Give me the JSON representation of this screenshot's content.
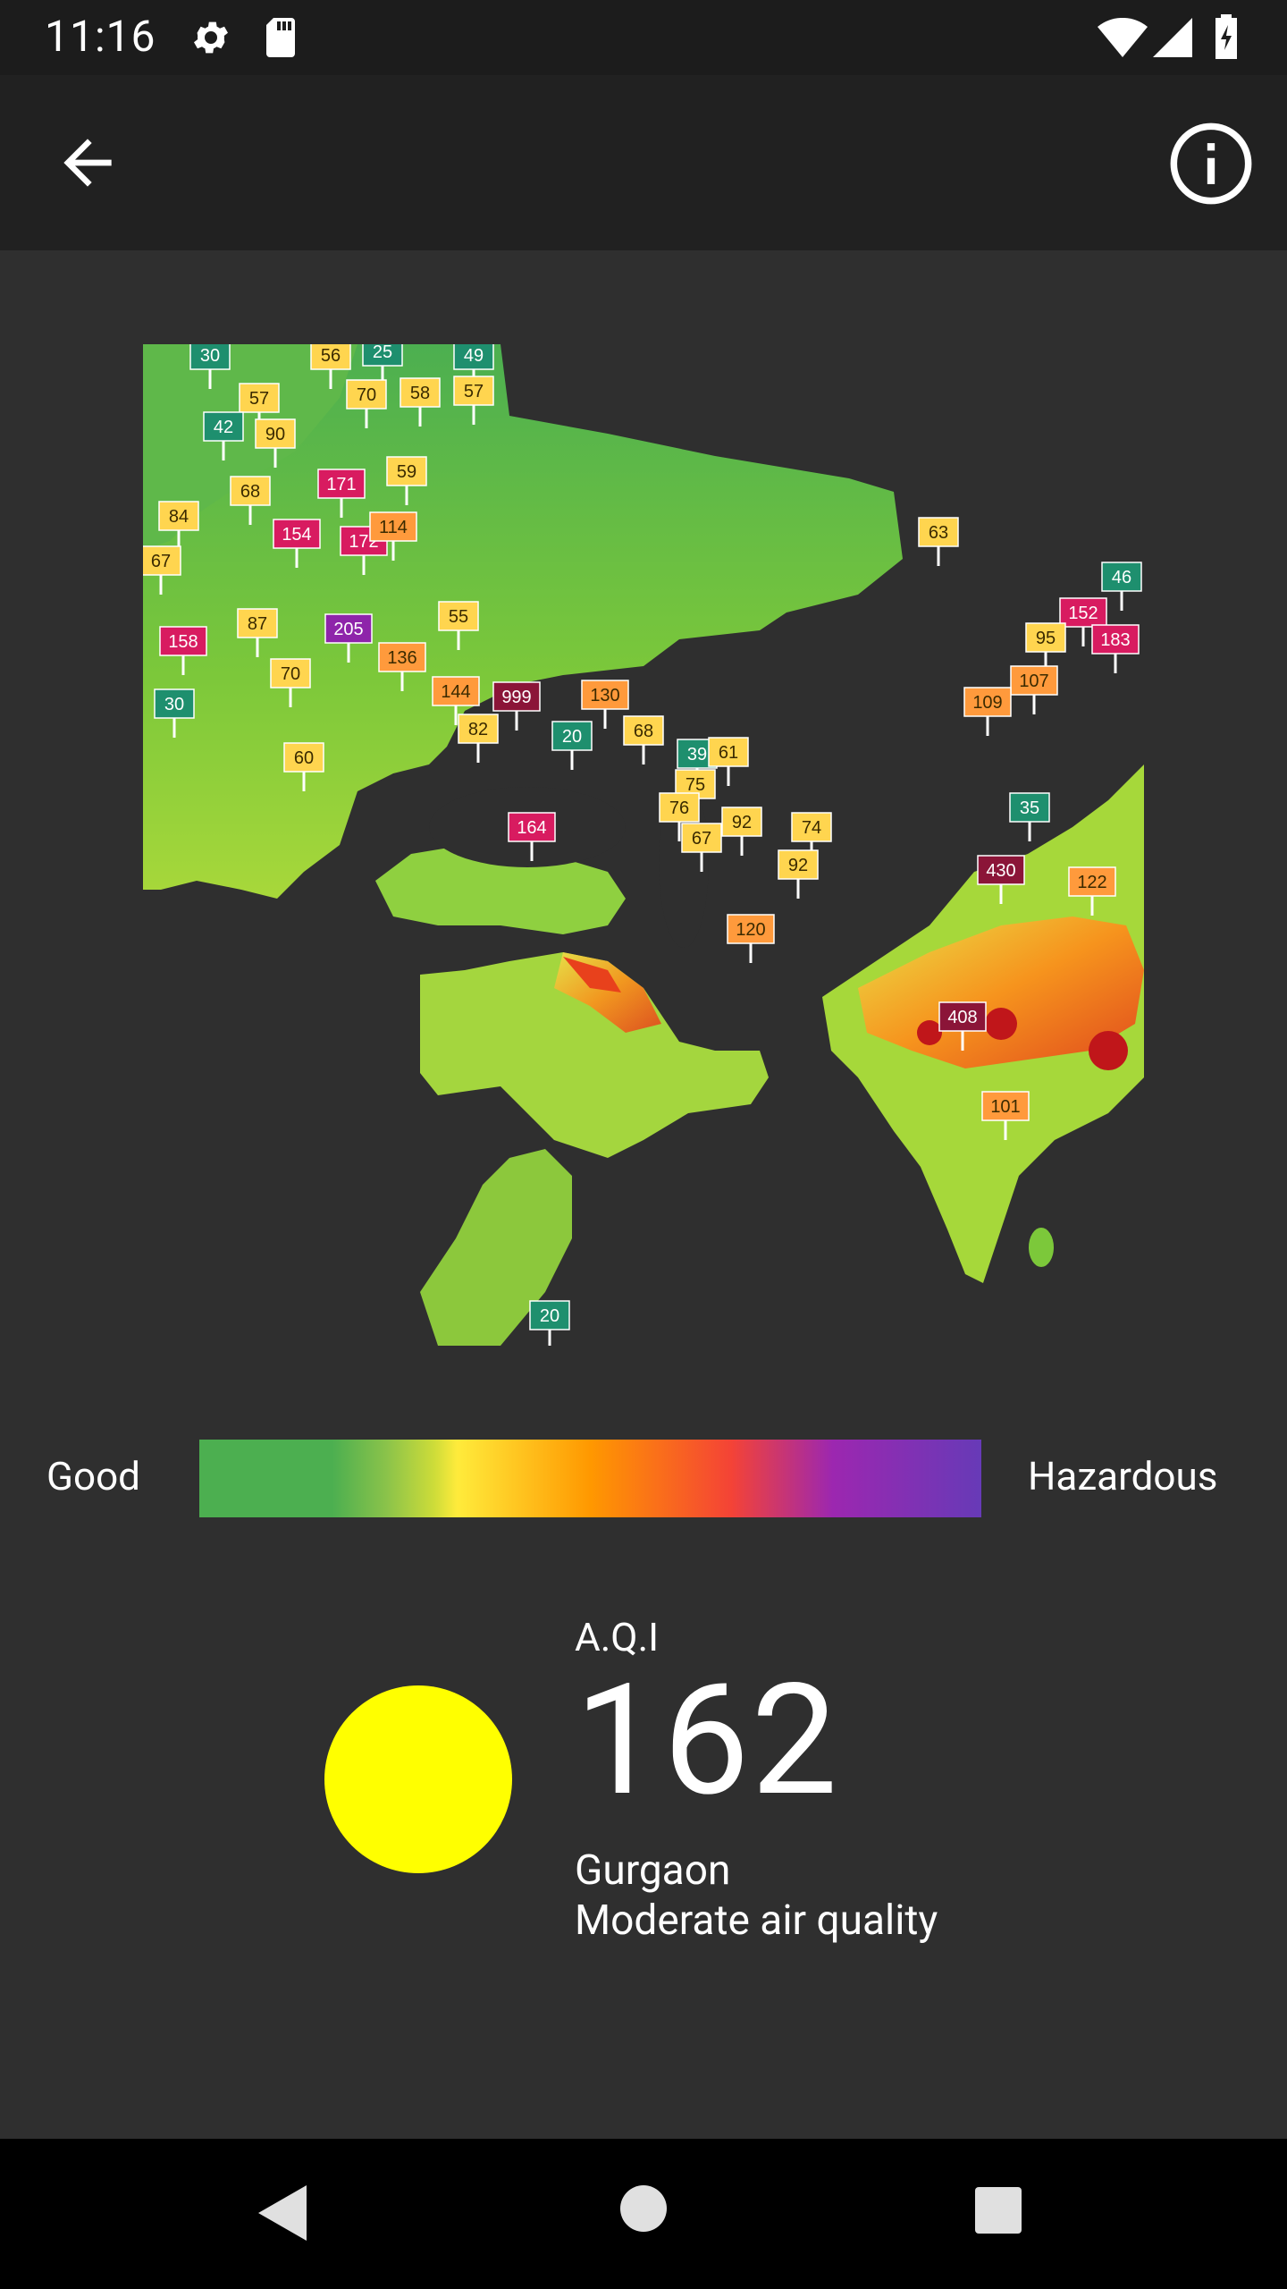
{
  "status_bar": {
    "time": "11:16",
    "icons": [
      "gear-icon",
      "sd-card-icon",
      "wifi-icon",
      "signal-icon",
      "battery-charging-icon"
    ]
  },
  "app_bar": {
    "back_icon": "arrow-back-icon",
    "info_icon": "info-icon"
  },
  "map": {
    "markers": [
      {
        "label": "30",
        "color": "#1e8f6e"
      },
      {
        "label": "56",
        "color": "#ffd54f"
      },
      {
        "label": "25",
        "color": "#1e8f6e"
      },
      {
        "label": "49",
        "color": "#1e8f6e"
      },
      {
        "label": "57",
        "color": "#ffd54f"
      },
      {
        "label": "70",
        "color": "#ffd54f"
      },
      {
        "label": "58",
        "color": "#ffd54f"
      },
      {
        "label": "57",
        "color": "#ffd54f"
      },
      {
        "label": "42",
        "color": "#1e8f6e"
      },
      {
        "label": "90",
        "color": "#ffd54f"
      },
      {
        "label": "59",
        "color": "#ffd54f"
      },
      {
        "label": "171",
        "color": "#d81b60"
      },
      {
        "label": "68",
        "color": "#ffd54f"
      },
      {
        "label": "84",
        "color": "#ffd54f"
      },
      {
        "label": "154",
        "color": "#d81b60"
      },
      {
        "label": "172",
        "color": "#d81b60"
      },
      {
        "label": "114",
        "color": "#ff9a3c"
      },
      {
        "label": "67",
        "color": "#ffd54f"
      },
      {
        "label": "63",
        "color": "#ffd54f"
      },
      {
        "label": "46",
        "color": "#1e8f6e"
      },
      {
        "label": "152",
        "color": "#d81b60"
      },
      {
        "label": "183",
        "color": "#d81b60"
      },
      {
        "label": "95",
        "color": "#ffd54f"
      },
      {
        "label": "87",
        "color": "#ffd54f"
      },
      {
        "label": "205",
        "color": "#8e24aa"
      },
      {
        "label": "55",
        "color": "#ffd54f"
      },
      {
        "label": "158",
        "color": "#d81b60"
      },
      {
        "label": "136",
        "color": "#ff9a3c"
      },
      {
        "label": "70",
        "color": "#ffd54f"
      },
      {
        "label": "30",
        "color": "#1e8f6e"
      },
      {
        "label": "144",
        "color": "#ff9a3c"
      },
      {
        "label": "999",
        "color": "#8b1538"
      },
      {
        "label": "130",
        "color": "#ff9a3c"
      },
      {
        "label": "107",
        "color": "#ff9a3c"
      },
      {
        "label": "109",
        "color": "#ff9a3c"
      },
      {
        "label": "82",
        "color": "#ffd54f"
      },
      {
        "label": "20",
        "color": "#1e8f6e"
      },
      {
        "label": "68",
        "color": "#ffd54f"
      },
      {
        "label": "39",
        "color": "#1e8f6e"
      },
      {
        "label": "61",
        "color": "#ffd54f"
      },
      {
        "label": "60",
        "color": "#ffd54f"
      },
      {
        "label": "75",
        "color": "#ffd54f"
      },
      {
        "label": "76",
        "color": "#ffd54f"
      },
      {
        "label": "92",
        "color": "#ffd54f"
      },
      {
        "label": "74",
        "color": "#ffd54f"
      },
      {
        "label": "35",
        "color": "#1e8f6e"
      },
      {
        "label": "164",
        "color": "#d81b60"
      },
      {
        "label": "67",
        "color": "#ffd54f"
      },
      {
        "label": "92",
        "color": "#ffd54f"
      },
      {
        "label": "430",
        "color": "#8b1538"
      },
      {
        "label": "122",
        "color": "#ff9a3c"
      },
      {
        "label": "120",
        "color": "#ff9a3c"
      },
      {
        "label": "408",
        "color": "#8b1538"
      },
      {
        "label": "101",
        "color": "#ff9a3c"
      },
      {
        "label": "20",
        "color": "#1e8f6e"
      }
    ]
  },
  "legend": {
    "good_label": "Good",
    "hazardous_label": "Hazardous"
  },
  "aqi": {
    "label": "A.Q.I",
    "value": "162",
    "city": "Gurgaon",
    "status": "Moderate air quality",
    "dot_color": "#ffff00"
  },
  "nav_bar": {
    "icons": [
      "back-triangle-icon",
      "home-circle-icon",
      "recents-square-icon"
    ]
  }
}
